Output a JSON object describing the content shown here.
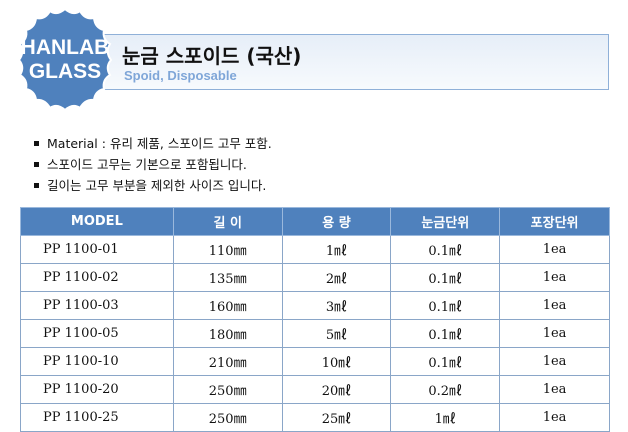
{
  "brand": {
    "line1": "HANLAB",
    "line2": "GLASS",
    "badge_color": "#4f81bd"
  },
  "header": {
    "title": "눈금 스포이드 (국산)",
    "subtitle": "Spoid, Disposable"
  },
  "notes": [
    "Material  : 유리 제품, 스포이드 고무 포함.",
    "스포이드 고무는 기본으로 포함됩니다.",
    "길이는 고무 부분을 제외한 사이즈 입니다."
  ],
  "table": {
    "header_color": "#4f81bd",
    "columns": [
      "MODEL",
      "길 이",
      "용 량",
      "눈금단위",
      "포장단위"
    ],
    "rows": [
      [
        "PP 1100-01",
        "110㎜",
        "1㎖",
        "0.1㎖",
        "1ea"
      ],
      [
        "PP 1100-02",
        "135㎜",
        "2㎖",
        "0.1㎖",
        "1ea"
      ],
      [
        "PP 1100-03",
        "160㎜",
        "3㎖",
        "0.1㎖",
        "1ea"
      ],
      [
        "PP 1100-05",
        "180㎜",
        "5㎖",
        "0.1㎖",
        "1ea"
      ],
      [
        "PP 1100-10",
        "210㎜",
        "10㎖",
        "0.1㎖",
        "1ea"
      ],
      [
        "PP 1100-20",
        "250㎜",
        "20㎖",
        "0.2㎖",
        "1ea"
      ],
      [
        "PP 1100-25",
        "250㎜",
        "25㎖",
        "1㎖",
        "1ea"
      ]
    ]
  }
}
